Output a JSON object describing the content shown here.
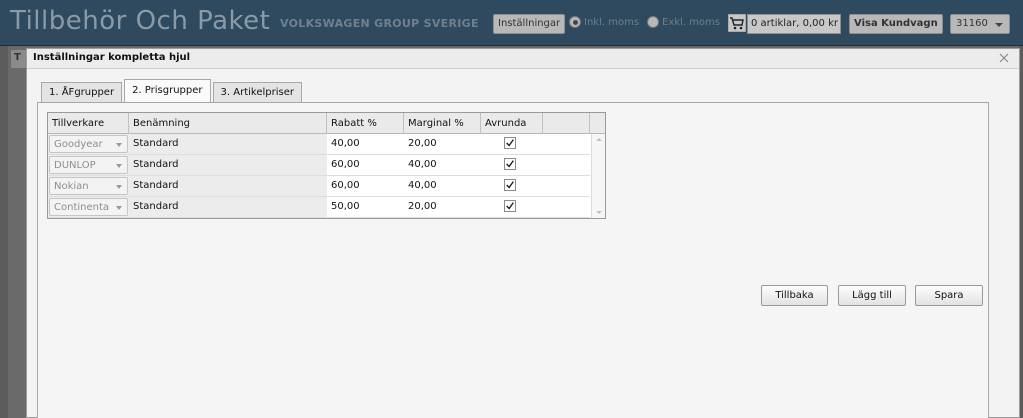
{
  "header": {
    "title": "Tillbehör Och Paket",
    "brand": "VOLKSWAGEN GROUP SVERIGE",
    "settings_button": "Inställningar",
    "vat_incl_label": "Inkl. moms",
    "vat_excl_label": "Exkl. moms",
    "cart_summary": "0 artiklar, 0,00 kr",
    "view_cart_button": "Visa Kundvagn",
    "account_select": "31160"
  },
  "background": {
    "tab_letter": "T"
  },
  "dialog": {
    "title": "Inställningar kompletta hjul",
    "tabs": [
      {
        "label": "1. ÅFgrupper"
      },
      {
        "label": "2. Prisgrupper"
      },
      {
        "label": "3. Artikelpriser"
      }
    ],
    "active_tab": "2. Prisgrupper",
    "grid": {
      "columns": [
        "Tillverkare",
        "Benämning",
        "Rabatt %",
        "Marginal %",
        "Avrunda"
      ],
      "rows": [
        {
          "manufacturer": "Goodyear",
          "name": "Standard",
          "discount": "40,00",
          "margin": "20,00",
          "round": true
        },
        {
          "manufacturer": "DUNLOP",
          "name": "Standard",
          "discount": "60,00",
          "margin": "40,00",
          "round": true
        },
        {
          "manufacturer": "Nokian",
          "name": "Standard",
          "discount": "60,00",
          "margin": "40,00",
          "round": true
        },
        {
          "manufacturer": "Continenta",
          "name": "Standard",
          "discount": "50,00",
          "margin": "20,00",
          "round": true
        }
      ]
    },
    "buttons": {
      "back": "Tillbaka",
      "add": "Lägg till",
      "save": "Spara"
    }
  },
  "colors": {
    "header_bg": "#2f4a5e",
    "dialog_bg": "#f3f3f3",
    "overlay": "#5c5c5c"
  }
}
